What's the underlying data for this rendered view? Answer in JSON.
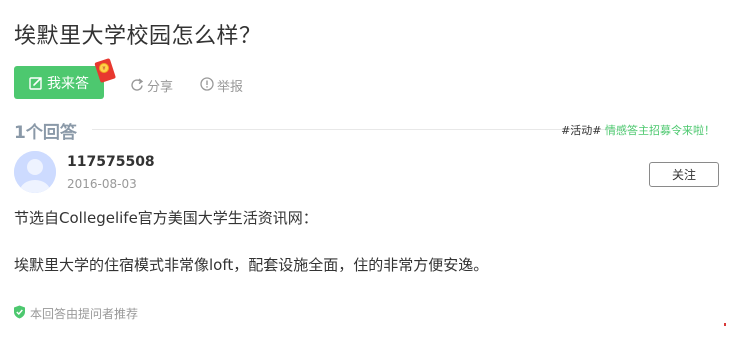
{
  "question": {
    "title": "埃默里大学校园怎么样？"
  },
  "actions": {
    "answer_label": "我来答",
    "share_label": "分享",
    "report_label": "举报"
  },
  "answers_header": {
    "count_label": "1个回答",
    "promo_tag": "#活动#",
    "promo_text": "情感答主招募令来啦！"
  },
  "answer": {
    "user_name": "117575508",
    "date": "2016-08-03",
    "follow_label": "关注",
    "paragraphs": [
      "节选自Collegelife官方美国大学生活资讯网：",
      "埃默里大学的住宿模式非常像loft，配套设施全面，住的非常方便安逸。"
    ],
    "recommended_label": "本回答由提问者推荐"
  },
  "colors": {
    "accent_green": "#4dc86f",
    "muted_gray": "#999999",
    "count_gray": "#8a99a8"
  }
}
